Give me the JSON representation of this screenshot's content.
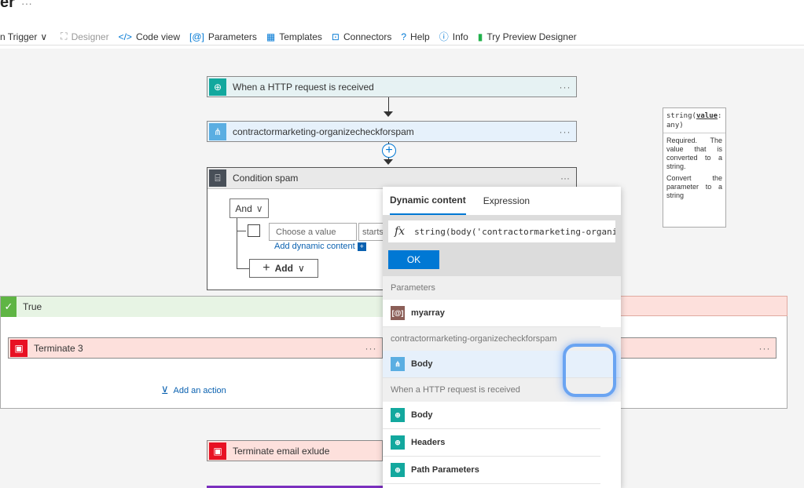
{
  "window": {
    "title": "er",
    "title_more": "···"
  },
  "toolbar": {
    "items": [
      {
        "label": "n Trigger",
        "icon": "chevron-down-icon"
      },
      {
        "label": "Designer",
        "icon": "designer-icon"
      },
      {
        "label": "Code view",
        "icon": "code-icon"
      },
      {
        "label": "Parameters",
        "icon": "parameters-icon"
      },
      {
        "label": "Templates",
        "icon": "templates-icon"
      },
      {
        "label": "Connectors",
        "icon": "connectors-icon"
      },
      {
        "label": "Help",
        "icon": "help-icon"
      },
      {
        "label": "Info",
        "icon": "info-icon"
      },
      {
        "label": "Try Preview Designer",
        "icon": "bookmark-icon"
      }
    ]
  },
  "flow": {
    "trigger": {
      "label": "When a HTTP request is received",
      "more": "···"
    },
    "step1": {
      "label": "contractormarketing-organizecheckforspam",
      "more": "···"
    },
    "condition": {
      "label": "Condition spam",
      "more": "···",
      "operator": "And",
      "value_placeholder": "Choose a value",
      "operator_text": "starts",
      "add_dynamic": "Add dynamic content",
      "add_label": "Add"
    },
    "true_branch": {
      "label": "True",
      "action": "Terminate 3",
      "action_more": "···",
      "add_action": "Add an action"
    },
    "false_branch": {
      "action_more": "···"
    },
    "after": {
      "label": "Terminate email exlude"
    }
  },
  "dynamic_panel": {
    "tabs": [
      "Dynamic content",
      "Expression"
    ],
    "expression": "string(body('contractormarketing-organizeche",
    "fx": "fx",
    "ok": "OK",
    "sections": [
      {
        "title": "Parameters",
        "items": [
          {
            "label": "myarray",
            "color": "#8b5e57"
          }
        ]
      },
      {
        "title": "contractormarketing-organizecheckforspam",
        "items": [
          {
            "label": "Body",
            "color": "#5aaee2"
          }
        ]
      },
      {
        "title": "When a HTTP request is received",
        "items": [
          {
            "label": "Body",
            "color": "#13a89e"
          },
          {
            "label": "Headers",
            "color": "#13a89e"
          },
          {
            "label": "Path Parameters",
            "color": "#13a89e"
          }
        ]
      }
    ]
  },
  "tooltip": {
    "sig_prefix": "string(",
    "sig_param": "value",
    "sig_suffix": ":",
    "sig_type": "any)",
    "desc1": "Required. The value that is converted to a string.",
    "desc2": "Convert the parameter to a string"
  },
  "colors": {
    "accent": "#0078d4",
    "teal": "#13a89e",
    "blue": "#5aaee2",
    "red": "#e81123",
    "green": "#5fb544"
  }
}
